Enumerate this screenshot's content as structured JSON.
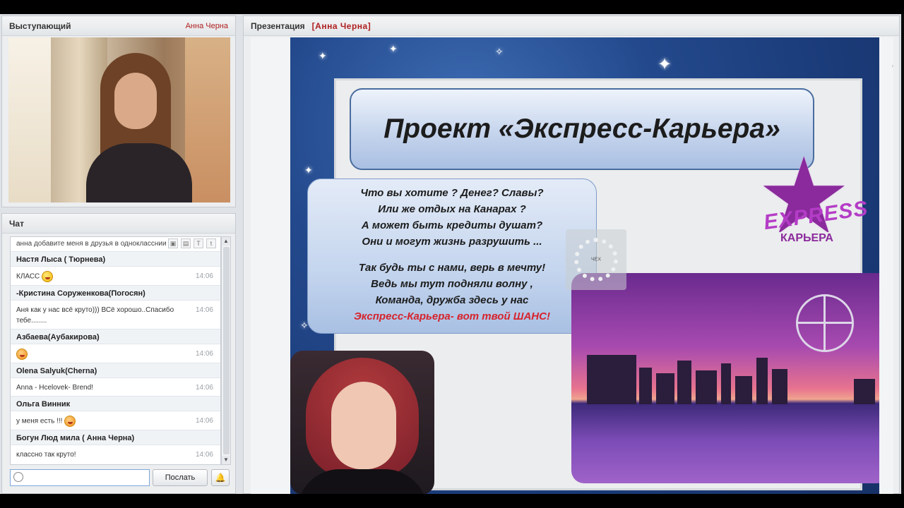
{
  "presenter_panel": {
    "title": "Выступающий",
    "presenter_name": "Анна Черна"
  },
  "chat_panel": {
    "title": "Чат",
    "top_line": "анна добавите меня в друзья в однокласснии",
    "messages": [
      {
        "author": "Настя Лыса ( Тюрнева)",
        "text": "КЛАСС",
        "emoji": "laugh",
        "time": "14:06"
      },
      {
        "author": "-Кристина Соруженкова(Погосян)",
        "text": "Аня как у нас всё круто))) ВСё хорошо..Спасибо тебе........",
        "time": "14:06"
      },
      {
        "author": "Азбаева(Аубакирова)",
        "text": "",
        "emoji": "kiss",
        "time": "14:06"
      },
      {
        "author": "Olena Salyuk(Cherna)",
        "text": "Anna - Hcelovek- Brend!",
        "time": "14:06"
      },
      {
        "author": "Ольга Винник",
        "text": "у меня есть !!!",
        "emoji": "wink",
        "time": "14:06"
      },
      {
        "author": "Богун Люд мила ( Анна Черна)",
        "text": "классно так круто!",
        "time": "14:06"
      }
    ],
    "input_value": "",
    "send_label": "Послать"
  },
  "presentation_panel": {
    "title": "Презентация",
    "author": "[Анна Черна]",
    "slide": {
      "title": "Проект «Экспресс-Карьера»",
      "poem_lines": [
        "Что вы хотите ? Денег? Славы?",
        "Или же отдых на Канарах ?",
        "А может быть кредиты душат?",
        "Они и могут жизнь разрушить ...",
        "Так будь ты с нами, верь в мечту!",
        "Ведь мы тут подняли волну ,",
        "Команда, дружба здесь у нас",
        "Экспресс-Карьера-  вот твой ШАНС!"
      ],
      "logo_word": "EXPRESS",
      "logo_sub": "КАРЬЕРА",
      "spinner_label": "ЧЕХ"
    }
  },
  "colors": {
    "accent_red": "#b01e1e",
    "slide_blue": "#23498c",
    "logo_purple": "#8a2a9c",
    "poem_highlight": "#d7232c"
  },
  "icons": [
    "smile-icon",
    "bell-icon",
    "text-size-icon",
    "clear-icon",
    "scroll-up-icon",
    "scroll-down-icon"
  ]
}
